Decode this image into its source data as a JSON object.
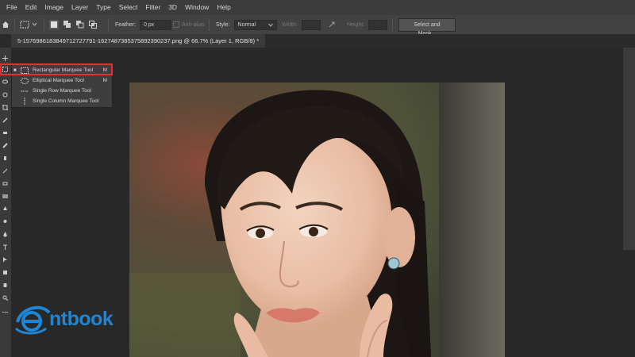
{
  "menu": [
    "File",
    "Edit",
    "Image",
    "Layer",
    "Type",
    "Select",
    "Filter",
    "3D",
    "Window",
    "Help"
  ],
  "options": {
    "feather_label": "Feather:",
    "feather_value": "0 px",
    "antialias_label": "Anti-alias",
    "style_label": "Style:",
    "style_value": "Normal",
    "width_label": "Width:",
    "height_label": "Height:",
    "select_mask_label": "Select and Mask..."
  },
  "document_tab": "5-1576986183849712727791-1627487385375892390237.png @ 66.7% (Layer 1, RGB/8) *",
  "flyout": [
    {
      "label": "Rectangular Marquee Tool",
      "shortcut": "M",
      "icon": "rect-marquee-icon",
      "active": true
    },
    {
      "label": "Elliptical Marquee Tool",
      "shortcut": "M",
      "icon": "ellipse-marquee-icon"
    },
    {
      "label": "Single Row Marquee Tool",
      "shortcut": "",
      "icon": "single-row-marquee-icon"
    },
    {
      "label": "Single Column Marquee Tool",
      "shortcut": "",
      "icon": "single-column-marquee-icon"
    }
  ],
  "logo_text": "ntbook",
  "colors": {
    "highlight": "#e0322f",
    "logo": "#1f86d6",
    "ui_bg": "#282828"
  }
}
